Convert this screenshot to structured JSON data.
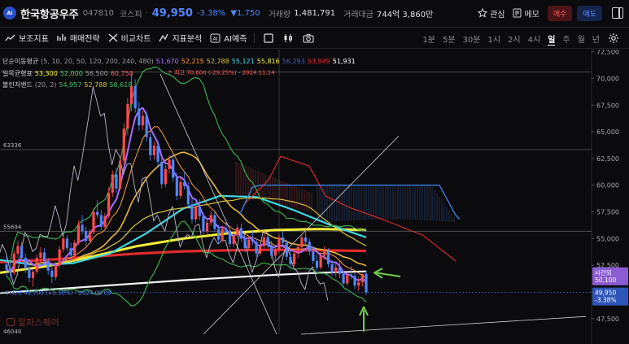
{
  "header": {
    "logo_text": "AI",
    "stock_name": "한국항공우주",
    "stock_code": "047810",
    "market": "코스피",
    "sep": "·",
    "price": "49,950",
    "change_pct": "-3.38%",
    "change_abs": "▼1,750",
    "volume_label": "거래량",
    "volume_value": "1,481,791",
    "amount_label": "거래대금",
    "amount_value": "744억 3,860만",
    "watch_label": "관심",
    "memo_label": "메모",
    "buy_label": "매수",
    "sell_label": "매도"
  },
  "toolbar": {
    "tools": [
      {
        "label": "보조지표",
        "icon": "indicator-icon"
      },
      {
        "label": "매매전략",
        "icon": "strategy-icon"
      },
      {
        "label": "비교차트",
        "icon": "compare-icon"
      },
      {
        "label": "지표분석",
        "icon": "analysis-icon"
      },
      {
        "label": "AI예측",
        "icon": "ai-icon"
      }
    ],
    "periods": [
      "1분",
      "5분",
      "30분",
      "1시",
      "2시",
      "4시",
      "일",
      "주",
      "월",
      "년"
    ],
    "active_period": "일"
  },
  "legend": {
    "sma_label": "단순이동평균",
    "sma_params": "(5, 10, 20, 50, 120, 200, 240, 480)",
    "sma_values": [
      {
        "value": "51,670",
        "color": "#a66bff"
      },
      {
        "value": "52,215",
        "color": "#ff9a3c"
      },
      {
        "value": "52,788",
        "color": "#d9c23a"
      },
      {
        "value": "55,121",
        "color": "#40d6e0"
      },
      {
        "value": "55,816",
        "color": "#f4ee3a"
      },
      {
        "value": "56,293",
        "color": "#3c5bd8"
      },
      {
        "value": "53,849",
        "color": "#e02a2a"
      },
      {
        "value": "51,931",
        "color": "#ffffff"
      }
    ],
    "ichimoku_label": "일목균형표",
    "ichimoku_values": [
      {
        "value": "53,300",
        "color": "#f4ee3a"
      },
      {
        "value": "52,000",
        "color": "#40d060"
      },
      {
        "value": "56,500",
        "color": "#9a9a9a"
      },
      {
        "value": "60,750",
        "color": "#ff5a5a"
      }
    ],
    "bollinger_label": "볼린저밴드",
    "bollinger_params": "(20, 2)",
    "bollinger_values": [
      {
        "value": "54,957",
        "color": "#40c060"
      },
      {
        "value": "52,788",
        "color": "#d9c23a"
      },
      {
        "value": "50,618",
        "color": "#40c060"
      }
    ]
  },
  "annotations": {
    "high": "최고 70,600 (-29.25%) - 2024.11.14",
    "low": "최저 49,700 (+0.50%) - 2024.09.09",
    "level_63336": "63336",
    "level_55694": "55694",
    "level_46040": "46040"
  },
  "axis": {
    "ticks": [
      "72,500",
      "70,000",
      "67,500",
      "65,000",
      "62,500",
      "60,000",
      "57,500",
      "55,000",
      "52,500",
      "50,000",
      "47,500"
    ],
    "current_label": "시간외",
    "current_value": "50,100",
    "last_price": "49,950",
    "last_change": "-3.38%"
  },
  "watermark": "알파스퀘어",
  "colors": {
    "blue_down": "#4f86ff",
    "red_up": "#ff4444",
    "accent_arrow": "#6fd04a"
  },
  "chart_data": {
    "type": "candlestick",
    "y_range": [
      46040,
      72700
    ],
    "candles": [
      [
        52600,
        53400,
        51500,
        52100
      ],
      [
        52100,
        52800,
        51200,
        51800
      ],
      [
        51800,
        53900,
        51600,
        53600
      ],
      [
        53600,
        54800,
        53200,
        54300
      ],
      [
        54300,
        54700,
        52900,
        53200
      ],
      [
        53200,
        53600,
        51800,
        52200
      ],
      [
        52200,
        52700,
        50900,
        51300
      ],
      [
        51300,
        52100,
        50500,
        51900
      ],
      [
        51900,
        53500,
        51700,
        53200
      ],
      [
        53200,
        54200,
        52800,
        53700
      ],
      [
        53700,
        54100,
        52600,
        52900
      ],
      [
        52900,
        53200,
        51600,
        52000
      ],
      [
        52000,
        52600,
        50800,
        51400
      ],
      [
        51400,
        52800,
        51100,
        52500
      ],
      [
        52500,
        54300,
        52300,
        54000
      ],
      [
        54000,
        55400,
        53700,
        55000
      ],
      [
        55000,
        55300,
        53800,
        54100
      ],
      [
        54100,
        54600,
        52900,
        53400
      ],
      [
        53400,
        54900,
        53200,
        54600
      ],
      [
        54600,
        56700,
        54400,
        56300
      ],
      [
        56300,
        57200,
        55400,
        55700
      ],
      [
        55700,
        56100,
        54300,
        54800
      ],
      [
        54800,
        55900,
        54500,
        55600
      ],
      [
        55600,
        57900,
        55400,
        57500
      ],
      [
        57500,
        58600,
        56900,
        57200
      ],
      [
        57200,
        57700,
        55800,
        56100
      ],
      [
        56100,
        57400,
        55900,
        57100
      ],
      [
        57100,
        59800,
        56900,
        59300
      ],
      [
        59300,
        61400,
        58900,
        61000
      ],
      [
        61000,
        61600,
        59300,
        59700
      ],
      [
        59700,
        62700,
        59500,
        62300
      ],
      [
        62300,
        65800,
        61900,
        65300
      ],
      [
        65300,
        68200,
        64700,
        67600
      ],
      [
        67600,
        70600,
        66900,
        69300
      ],
      [
        69300,
        69900,
        66800,
        67200
      ],
      [
        67200,
        67800,
        65100,
        65600
      ],
      [
        65600,
        67000,
        65200,
        66500
      ],
      [
        66500,
        66900,
        64100,
        64500
      ],
      [
        64500,
        65000,
        62300,
        62800
      ],
      [
        62800,
        64100,
        62400,
        63700
      ],
      [
        63700,
        64200,
        61800,
        62200
      ],
      [
        62200,
        62600,
        59700,
        60100
      ],
      [
        60100,
        61900,
        59800,
        61500
      ],
      [
        61500,
        62800,
        61100,
        62400
      ],
      [
        62400,
        62900,
        60300,
        60700
      ],
      [
        60700,
        61200,
        58600,
        59000
      ],
      [
        59000,
        60700,
        58700,
        60300
      ],
      [
        60300,
        61300,
        59600,
        59900
      ],
      [
        59900,
        60300,
        57800,
        58200
      ],
      [
        58200,
        58800,
        56400,
        56800
      ],
      [
        56800,
        58400,
        56500,
        58000
      ],
      [
        58000,
        58700,
        56700,
        57100
      ],
      [
        57100,
        57400,
        55300,
        55700
      ],
      [
        55700,
        56900,
        55400,
        56500
      ],
      [
        56500,
        57600,
        56200,
        57200
      ],
      [
        57200,
        57500,
        55600,
        55900
      ],
      [
        55900,
        56300,
        54500,
        54900
      ],
      [
        54900,
        56200,
        54600,
        55900
      ],
      [
        55900,
        56800,
        55400,
        55600
      ],
      [
        55600,
        55900,
        54200,
        54500
      ],
      [
        54500,
        55600,
        54200,
        55300
      ],
      [
        55300,
        56300,
        55000,
        56000
      ],
      [
        56000,
        56400,
        54700,
        55000
      ],
      [
        55000,
        55300,
        53700,
        54100
      ],
      [
        54100,
        55200,
        53900,
        54900
      ],
      [
        54900,
        55700,
        54400,
        54700
      ],
      [
        54700,
        55000,
        53300,
        53600
      ],
      [
        53600,
        54600,
        53400,
        54300
      ],
      [
        54300,
        55400,
        54000,
        55100
      ],
      [
        55100,
        55600,
        54100,
        54400
      ],
      [
        54400,
        54800,
        53100,
        53400
      ],
      [
        53400,
        54200,
        52800,
        53900
      ],
      [
        53900,
        55400,
        53700,
        55100
      ],
      [
        55100,
        55700,
        54300,
        54600
      ],
      [
        54600,
        54900,
        53000,
        53300
      ],
      [
        53300,
        53800,
        52300,
        52600
      ],
      [
        52600,
        53900,
        52400,
        53600
      ],
      [
        53600,
        54500,
        53200,
        54200
      ],
      [
        54200,
        55400,
        53900,
        55100
      ],
      [
        55100,
        55800,
        54400,
        54700
      ],
      [
        54700,
        55000,
        53400,
        53800
      ],
      [
        53800,
        54200,
        52600,
        52900
      ],
      [
        52900,
        53500,
        52000,
        52300
      ],
      [
        52300,
        53700,
        52100,
        53400
      ],
      [
        53400,
        54300,
        53000,
        53800
      ],
      [
        53800,
        54100,
        52300,
        52600
      ],
      [
        52600,
        53000,
        51500,
        51800
      ],
      [
        51800,
        52700,
        51400,
        52300
      ],
      [
        52300,
        52900,
        51300,
        51700
      ],
      [
        51700,
        51900,
        50400,
        50800
      ],
      [
        50800,
        51900,
        50600,
        51600
      ],
      [
        51600,
        52400,
        51200,
        51500
      ],
      [
        51500,
        51800,
        50300,
        50600
      ],
      [
        50600,
        51300,
        50100,
        50900
      ],
      [
        50900,
        51500,
        50500,
        51700
      ],
      [
        51700,
        52000,
        49700,
        49950
      ]
    ],
    "overlays": {
      "ichimoku_cloud_top": [
        [
          55,
          60000
        ],
        [
          78,
          60000
        ],
        [
          95,
          56500
        ]
      ],
      "bollinger_upper_last": 54957,
      "bollinger_mid_last": 52788,
      "bollinger_lower_last": 50618
    }
  }
}
